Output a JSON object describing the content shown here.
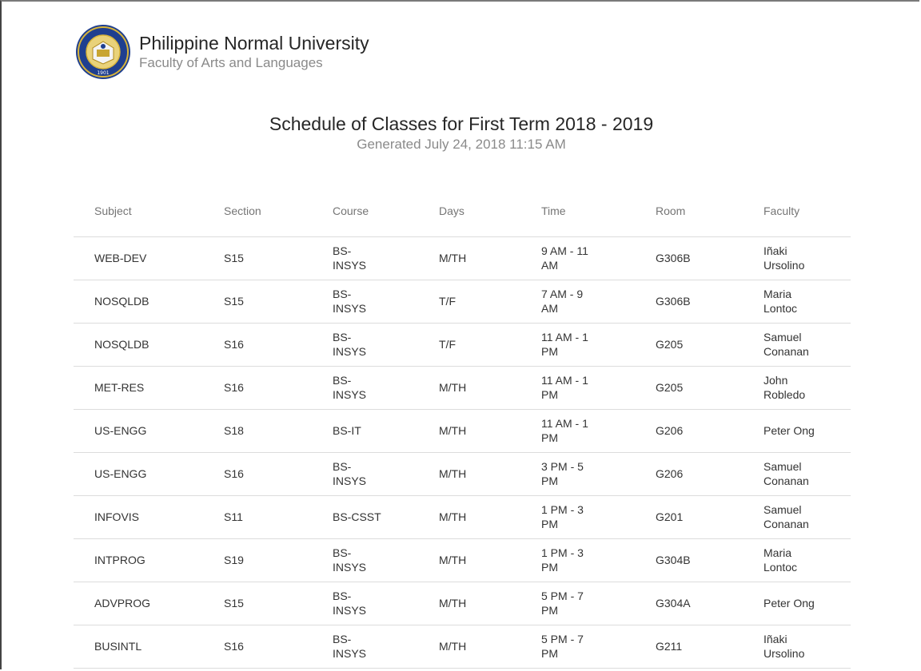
{
  "header": {
    "org_name": "Philippine Normal University",
    "org_sub": "Faculty of Arts and Languages",
    "seal_text_top": "PHILIPPINE NORMAL UNIVERSITY",
    "seal_year": "1901"
  },
  "document": {
    "title": "Schedule of Classes for First Term 2018 - 2019",
    "generated": "Generated July 24, 2018 11:15 AM"
  },
  "table": {
    "columns": [
      "Subject",
      "Section",
      "Course",
      "Days",
      "Time",
      "Room",
      "Faculty"
    ],
    "rows": [
      {
        "subject": "WEB-DEV",
        "section": "S15",
        "course": "BS-INSYS",
        "days": "M/TH",
        "time": "9 AM - 11 AM",
        "room": "G306B",
        "faculty": "Iñaki Ursolino"
      },
      {
        "subject": "NOSQLDB",
        "section": "S15",
        "course": "BS-INSYS",
        "days": "T/F",
        "time": "7 AM - 9 AM",
        "room": "G306B",
        "faculty": "Maria Lontoc"
      },
      {
        "subject": "NOSQLDB",
        "section": "S16",
        "course": "BS-INSYS",
        "days": "T/F",
        "time": "11 AM - 1 PM",
        "room": "G205",
        "faculty": "Samuel Conanan"
      },
      {
        "subject": "MET-RES",
        "section": "S16",
        "course": "BS-INSYS",
        "days": "M/TH",
        "time": "11 AM - 1 PM",
        "room": "G205",
        "faculty": "John Robledo"
      },
      {
        "subject": "US-ENGG",
        "section": "S18",
        "course": "BS-IT",
        "days": "M/TH",
        "time": "11 AM - 1 PM",
        "room": "G206",
        "faculty": "Peter Ong"
      },
      {
        "subject": "US-ENGG",
        "section": "S16",
        "course": "BS-INSYS",
        "days": "M/TH",
        "time": "3 PM - 5 PM",
        "room": "G206",
        "faculty": "Samuel Conanan"
      },
      {
        "subject": "INFOVIS",
        "section": "S11",
        "course": "BS-CSST",
        "days": "M/TH",
        "time": "1 PM - 3 PM",
        "room": "G201",
        "faculty": "Samuel Conanan"
      },
      {
        "subject": "INTPROG",
        "section": "S19",
        "course": "BS-INSYS",
        "days": "M/TH",
        "time": "1 PM - 3 PM",
        "room": "G304B",
        "faculty": "Maria Lontoc"
      },
      {
        "subject": "ADVPROG",
        "section": "S15",
        "course": "BS-INSYS",
        "days": "M/TH",
        "time": "5 PM - 7 PM",
        "room": "G304A",
        "faculty": "Peter Ong"
      },
      {
        "subject": "BUSINTL",
        "section": "S16",
        "course": "BS-INSYS",
        "days": "M/TH",
        "time": "5 PM - 7 PM",
        "room": "G211",
        "faculty": "Iñaki Ursolino"
      }
    ]
  },
  "colors": {
    "seal_blue": "#1f3f8f",
    "seal_gold": "#d8b43a",
    "rule": "#dcdcdc"
  }
}
